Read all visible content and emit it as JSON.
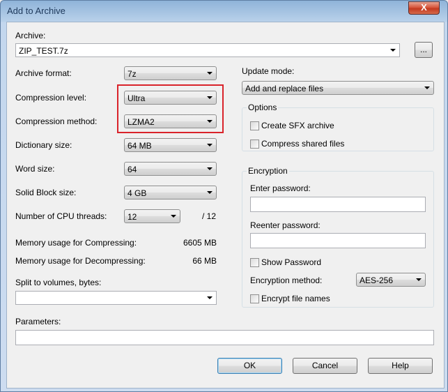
{
  "window": {
    "title": "Add to Archive",
    "close_symbol": "X"
  },
  "archive": {
    "label": "Archive:",
    "value": "ZIP_TEST.7z",
    "browse_label": "..."
  },
  "left": {
    "archive_format": {
      "label": "Archive format:",
      "value": "7z"
    },
    "compression_level": {
      "label": "Compression level:",
      "value": "Ultra"
    },
    "compression_method": {
      "label": "Compression method:",
      "value": "LZMA2"
    },
    "dictionary_size": {
      "label": "Dictionary size:",
      "value": "64 MB"
    },
    "word_size": {
      "label": "Word size:",
      "value": "64"
    },
    "solid_block_size": {
      "label": "Solid Block size:",
      "value": "4 GB"
    },
    "cpu_threads": {
      "label": "Number of CPU threads:",
      "value": "12",
      "total": "/ 12"
    },
    "memory_compress": {
      "label": "Memory usage for Compressing:",
      "value": "6605 MB"
    },
    "memory_decompress": {
      "label": "Memory usage for Decompressing:",
      "value": "66 MB"
    },
    "split_volumes": {
      "label": "Split to volumes, bytes:",
      "value": ""
    }
  },
  "right": {
    "update_mode": {
      "label": "Update mode:",
      "value": "Add and replace files"
    },
    "options": {
      "title": "Options",
      "create_sfx": {
        "label": "Create SFX archive",
        "checked": false
      },
      "compress_shared": {
        "label": "Compress shared files",
        "checked": false
      }
    },
    "encryption": {
      "title": "Encryption",
      "enter_password": {
        "label": "Enter password:",
        "value": ""
      },
      "reenter_password": {
        "label": "Reenter password:",
        "value": ""
      },
      "show_password": {
        "label": "Show Password",
        "checked": false
      },
      "method": {
        "label": "Encryption method:",
        "value": "AES-256"
      },
      "encrypt_names": {
        "label": "Encrypt file names",
        "checked": false
      }
    }
  },
  "parameters": {
    "label": "Parameters:",
    "value": ""
  },
  "buttons": {
    "ok": "OK",
    "cancel": "Cancel",
    "help": "Help"
  },
  "colors": {
    "highlight": "#d9232a",
    "title_text": "#1e395b",
    "close_button": "#c33a1f"
  }
}
